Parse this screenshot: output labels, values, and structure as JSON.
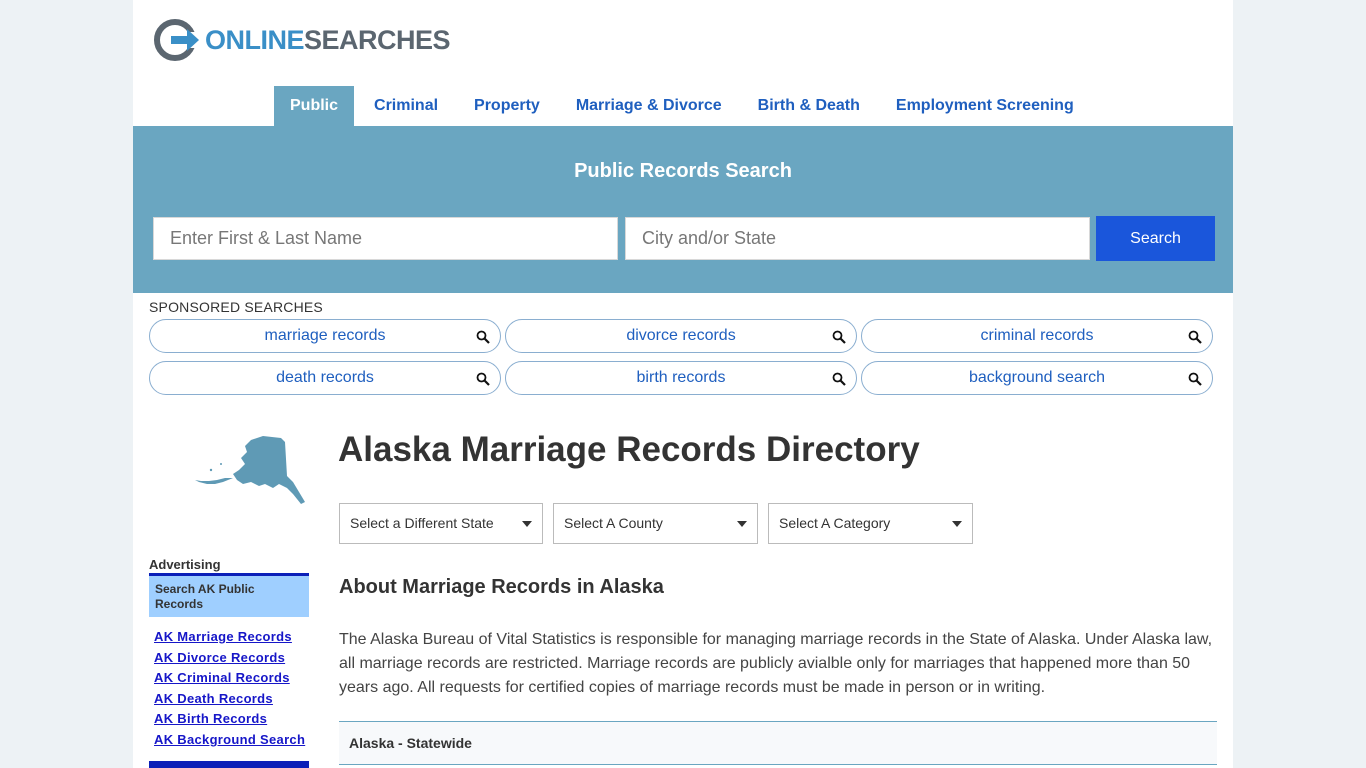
{
  "site": {
    "logo_word1": "ONLINE",
    "logo_word2": "SEARCHES"
  },
  "nav": [
    {
      "label": "Public",
      "active": true
    },
    {
      "label": "Criminal",
      "active": false
    },
    {
      "label": "Property",
      "active": false
    },
    {
      "label": "Marriage & Divorce",
      "active": false
    },
    {
      "label": "Birth & Death",
      "active": false
    },
    {
      "label": "Employment Screening",
      "active": false
    }
  ],
  "hero": {
    "title": "Public Records Search",
    "name_placeholder": "Enter First & Last Name",
    "location_placeholder": "City and/or State",
    "search_label": "Search"
  },
  "sponsored": {
    "label": "SPONSORED SEARCHES",
    "items": [
      "marriage records",
      "divorce records",
      "criminal records",
      "death records",
      "birth records",
      "background search"
    ]
  },
  "sidebar": {
    "advertising_title": "Advertising",
    "box_title": "Search AK Public Records",
    "links": [
      "AK Marriage Records",
      "AK Divorce Records",
      "AK Criminal Records",
      "AK Death Records",
      "AK Birth Records",
      "AK Background Search"
    ]
  },
  "main": {
    "title": "Alaska Marriage Records Directory",
    "selects": [
      "Select a Different State",
      "Select A County",
      "Select A Category"
    ],
    "section_title": "About Marriage Records in Alaska",
    "body": "The Alaska Bureau of Vital Statistics is responsible for managing marriage records in the State of Alaska. Under Alaska law, all marriage records are restricted. Marriage records are publicly avialble only for marriages that happened more than 50 years ago. All requests for certified copies of marriage records must be made in person or in writing.",
    "statewide_label": "Alaska - Statewide"
  },
  "colors": {
    "accent": "#6aa6c1",
    "button": "#1a56db",
    "link": "#1f5fbf",
    "ad_box": "#9fcfff",
    "ad_border": "#0b1fb8"
  }
}
